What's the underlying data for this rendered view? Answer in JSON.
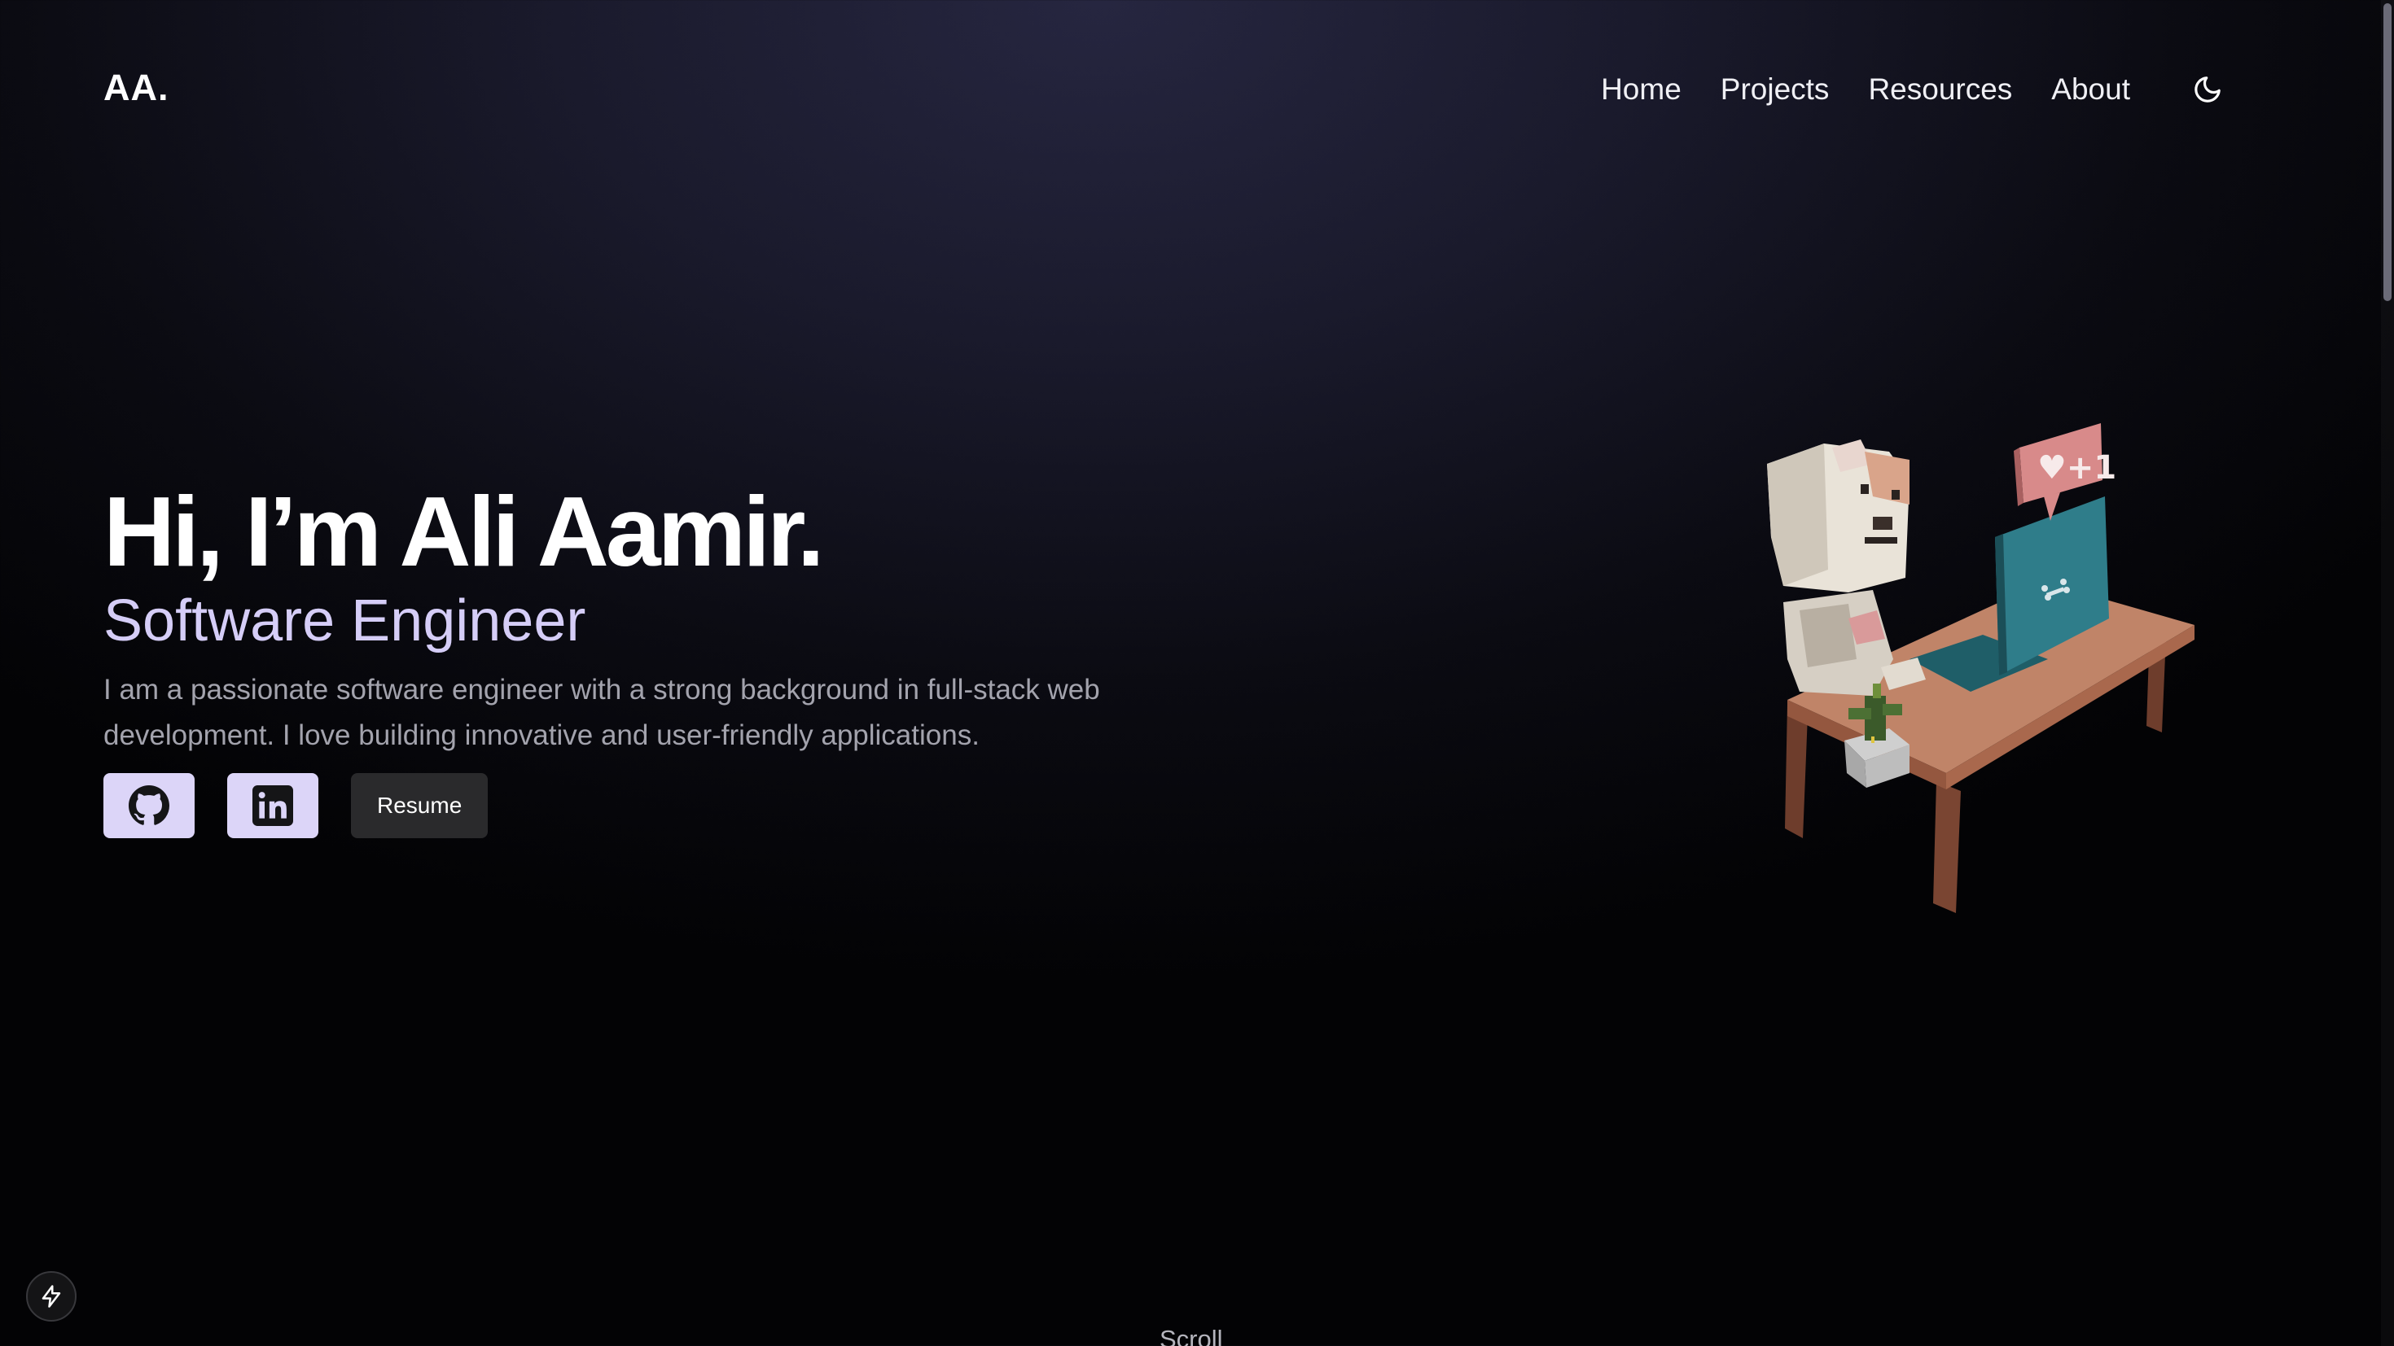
{
  "header": {
    "logo": "AA.",
    "nav": {
      "home": "Home",
      "projects": "Projects",
      "resources": "Resources",
      "about": "About"
    },
    "theme_icon": "moon-icon"
  },
  "hero": {
    "title": "Hi, I’m Ali Aamir.",
    "subtitle": "Software Engineer",
    "description": "I am a passionate software engineer with a strong background in full-stack web development. I love building innovative and user-friendly applications.",
    "buttons": {
      "github_icon": "github-icon",
      "linkedin_icon": "linkedin-icon",
      "resume": "Resume"
    },
    "illustration_badge": "♥+1"
  },
  "footer": {
    "scroll_label": "Scroll",
    "bolt_icon": "lightning-icon"
  },
  "colors": {
    "accent": "#d5cdf7",
    "icon_button_bg": "#dcd5f8",
    "resume_bg": "#2a2a2c"
  }
}
